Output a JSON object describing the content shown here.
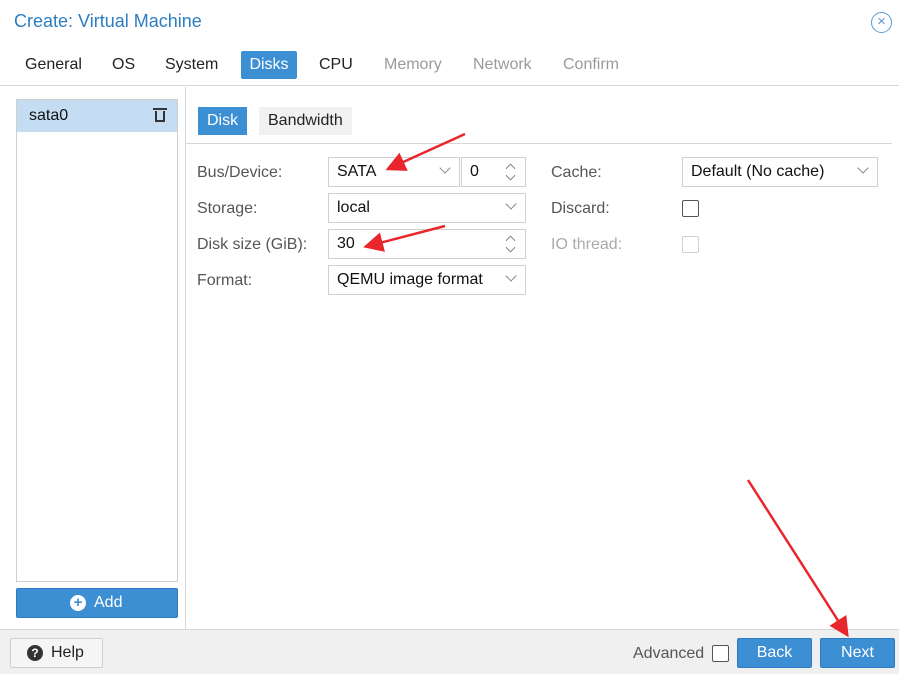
{
  "dialog": {
    "title": "Create: Virtual Machine",
    "close_icon": "close-icon"
  },
  "tabs": [
    {
      "label": "General",
      "state": "normal"
    },
    {
      "label": "OS",
      "state": "normal"
    },
    {
      "label": "System",
      "state": "normal"
    },
    {
      "label": "Disks",
      "state": "active"
    },
    {
      "label": "CPU",
      "state": "normal"
    },
    {
      "label": "Memory",
      "state": "disabled"
    },
    {
      "label": "Network",
      "state": "disabled"
    },
    {
      "label": "Confirm",
      "state": "disabled"
    }
  ],
  "disk_list": {
    "items": [
      {
        "label": "sata0",
        "selected": true
      }
    ],
    "add_label": "Add"
  },
  "subtabs": [
    {
      "label": "Disk",
      "active": true
    },
    {
      "label": "Bandwidth",
      "active": false
    }
  ],
  "form": {
    "bus_device": {
      "label": "Bus/Device:",
      "bus": "SATA",
      "device": "0"
    },
    "storage": {
      "label": "Storage:",
      "value": "local"
    },
    "disk_size": {
      "label": "Disk size (GiB):",
      "value": "30"
    },
    "format": {
      "label": "Format:",
      "value": "QEMU image format"
    },
    "cache": {
      "label": "Cache:",
      "value": "Default (No cache)"
    },
    "discard": {
      "label": "Discard:",
      "checked": false
    },
    "io_thread": {
      "label": "IO thread:",
      "checked": false,
      "disabled": true
    }
  },
  "footer": {
    "help_label": "Help",
    "advanced_label": "Advanced",
    "advanced_checked": false,
    "back_label": "Back",
    "next_label": "Next"
  },
  "colors": {
    "accent": "#3d8fd4",
    "title": "#2c7ec1",
    "annotation_arrow": "#e8262b",
    "selected_row": "#c4ddf3"
  }
}
